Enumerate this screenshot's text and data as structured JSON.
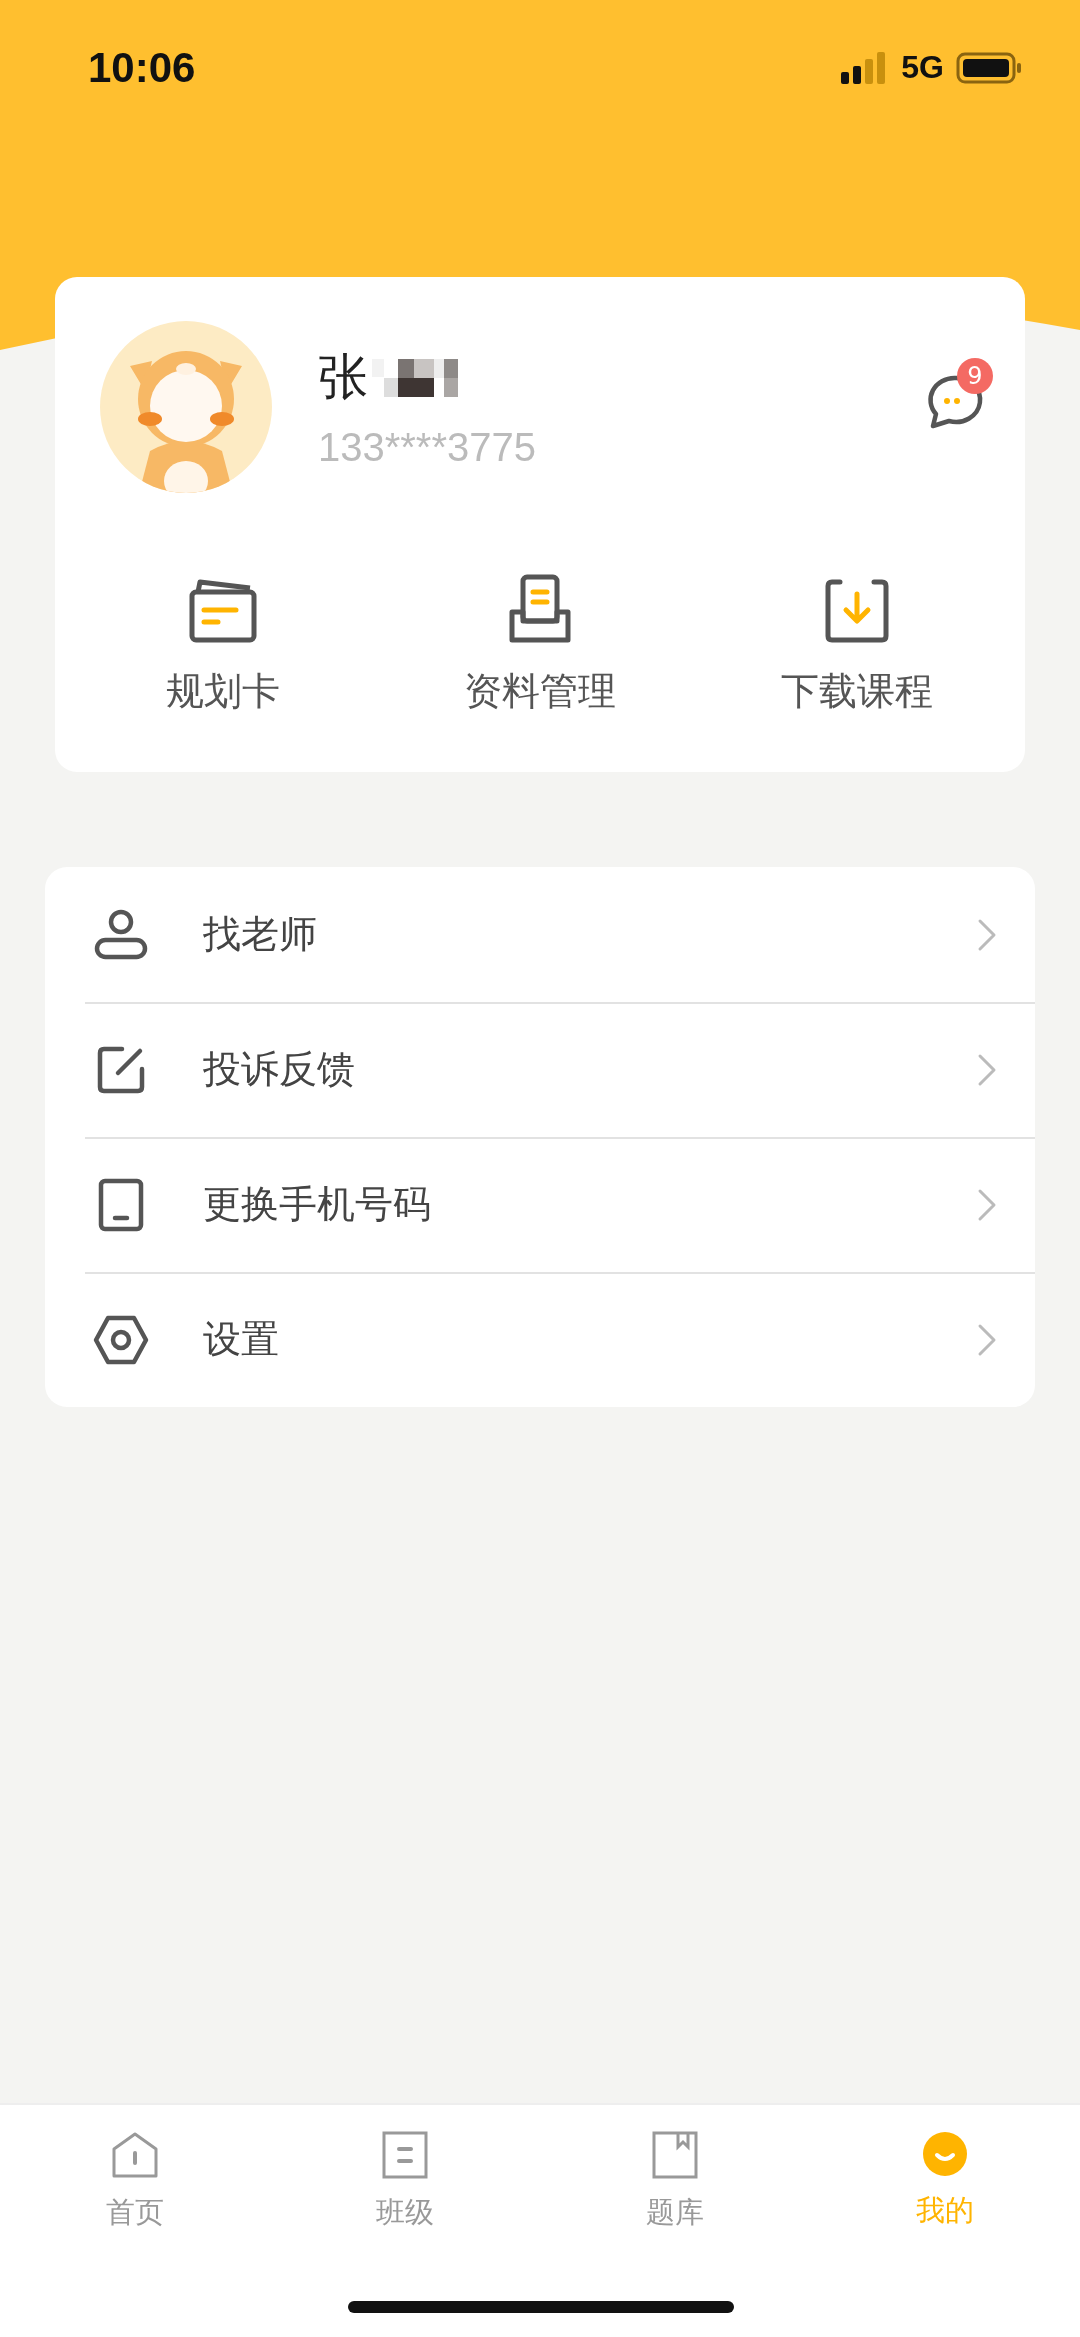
{
  "status_bar": {
    "time": "10:06",
    "network": "5G"
  },
  "profile": {
    "name": "张",
    "phone": "133****3775",
    "message_badge": "9"
  },
  "quick_actions": [
    {
      "label": "规划卡",
      "kind": "card"
    },
    {
      "label": "资料管理",
      "kind": "tray"
    },
    {
      "label": "下载课程",
      "kind": "download"
    }
  ],
  "menu": [
    {
      "label": "找老师",
      "kind": "person"
    },
    {
      "label": "投诉反馈",
      "kind": "edit"
    },
    {
      "label": "更换手机号码",
      "kind": "phone"
    },
    {
      "label": "设置",
      "kind": "settings"
    }
  ],
  "tab_bar": [
    {
      "label": "首页",
      "kind": "home",
      "selected": false
    },
    {
      "label": "班级",
      "kind": "class",
      "selected": false
    },
    {
      "label": "题库",
      "kind": "book",
      "selected": false
    },
    {
      "label": "我的",
      "kind": "me",
      "selected": true
    }
  ]
}
